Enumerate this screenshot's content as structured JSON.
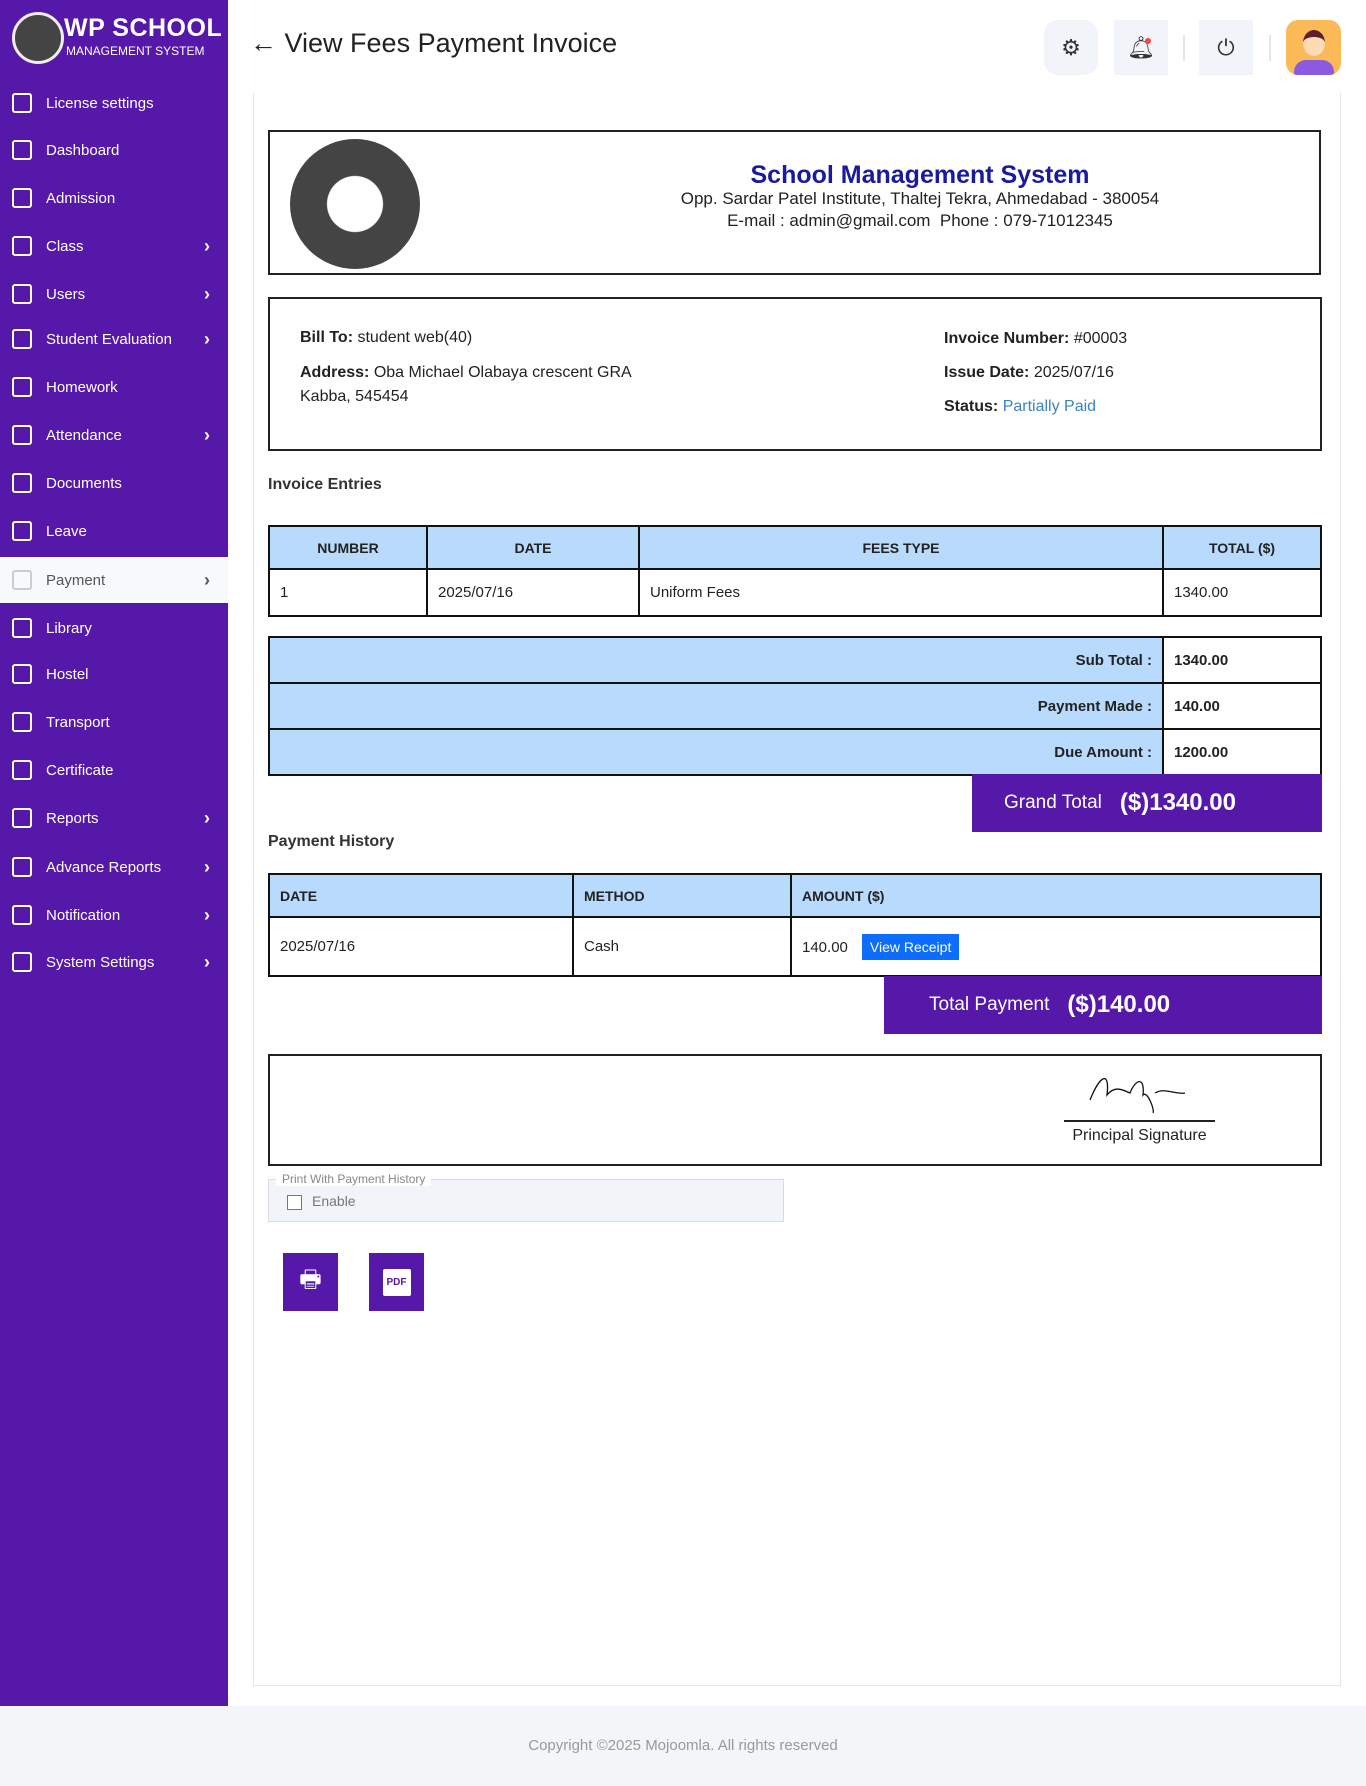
{
  "brand": {
    "title": "WP SCHOOL",
    "subtitle": "MANAGEMENT SYSTEM"
  },
  "sidebar": {
    "items": [
      {
        "label": "License settings",
        "chevron": false
      },
      {
        "label": "Dashboard",
        "chevron": false
      },
      {
        "label": "Admission",
        "chevron": false
      },
      {
        "label": "Class",
        "chevron": true
      },
      {
        "label": "Users",
        "chevron": true
      },
      {
        "label": "Student Evaluation",
        "chevron": true
      },
      {
        "label": "Homework",
        "chevron": false
      },
      {
        "label": "Attendance",
        "chevron": true
      },
      {
        "label": "Documents",
        "chevron": false
      },
      {
        "label": "Leave",
        "chevron": false
      },
      {
        "label": "Payment",
        "chevron": true,
        "active": true
      },
      {
        "label": "Library",
        "chevron": false
      },
      {
        "label": "Hostel",
        "chevron": false
      },
      {
        "label": "Transport",
        "chevron": false
      },
      {
        "label": "Certificate",
        "chevron": false
      },
      {
        "label": "Reports",
        "chevron": true
      },
      {
        "label": "Advance Reports",
        "chevron": true
      },
      {
        "label": "Notification",
        "chevron": true
      },
      {
        "label": "System Settings",
        "chevron": true
      }
    ]
  },
  "header": {
    "title": "View Fees Payment Invoice",
    "back": "←",
    "icons": [
      "gear-icon",
      "bell-icon",
      "power-icon",
      "avatar"
    ]
  },
  "school": {
    "name": "School Management System",
    "address": "Opp. Sardar Patel Institute, Thaltej Tekra, Ahmedabad - 380054",
    "contact": "E-mail : admin@gmail.com  Phone : 079-71012345"
  },
  "bill": {
    "bill_to_label": "Bill To:",
    "bill_to": "student web(40)",
    "address_label": "Address:",
    "address1": "Oba Michael Olabaya crescent GRA",
    "address2": "Kabba, 545454",
    "invoice_label": "Invoice Number:",
    "invoice": "#00003",
    "issue_label": "Issue Date:",
    "issue": "2025/07/16",
    "status_label": "Status:",
    "status": "Partially Paid",
    "status_color": "#3b82c4"
  },
  "entries": {
    "title": "Invoice Entries",
    "headers": [
      "NUMBER",
      "DATE",
      "FEES TYPE",
      "TOTAL ($)"
    ],
    "rows": [
      [
        "1",
        "2025/07/16",
        "Uniform Fees",
        "1340.00"
      ]
    ]
  },
  "totals": {
    "sub_label": "Sub Total :",
    "sub": "1340.00",
    "paid_label": "Payment Made :",
    "paid": "140.00",
    "due_label": "Due Amount :",
    "due": "1200.00",
    "grand_label": "Grand Total",
    "grand": "($)1340.00"
  },
  "history": {
    "title": "Payment History",
    "headers": [
      "DATE",
      "METHOD",
      "AMOUNT ($)"
    ],
    "rows": [
      [
        "2025/07/16",
        "Cash",
        "140.00"
      ]
    ],
    "receipt_label": "View Receipt",
    "total_label": "Total Payment",
    "total": "($)140.00"
  },
  "signature": {
    "label": "Principal Signature"
  },
  "print": {
    "legend": "Print With Payment History",
    "checkbox": "Enable",
    "checked": false
  },
  "colors": {
    "brand": "#5618a8",
    "table_header": "#b8dbfd",
    "button": "#0d6efd"
  },
  "footer": "Copyright ©2025 Mojoomla. All rights reserved"
}
